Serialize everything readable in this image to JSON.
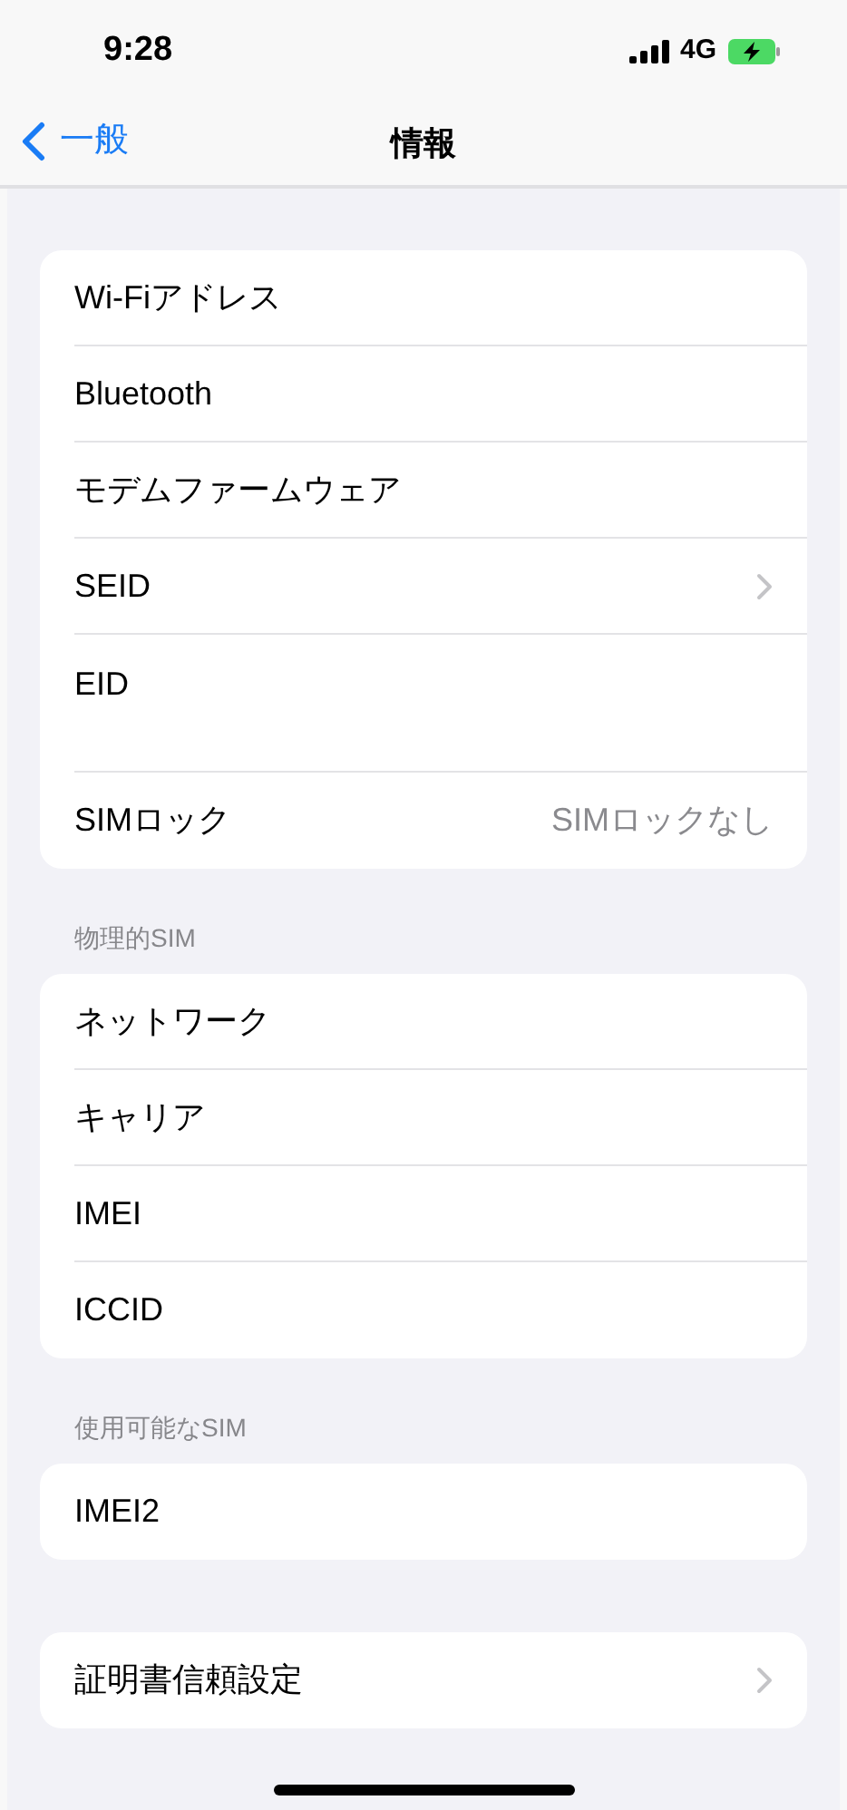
{
  "status_bar": {
    "time": "9:28",
    "network": "4G"
  },
  "nav": {
    "back": "一般",
    "title": "情報"
  },
  "groups": [
    {
      "rows": [
        {
          "label": "Wi-Fiアドレス",
          "kind": "plain"
        },
        {
          "label": "Bluetooth",
          "kind": "plain"
        },
        {
          "label": "モデムファームウェア",
          "kind": "plain"
        },
        {
          "label": "SEID",
          "kind": "link"
        },
        {
          "label": "EID",
          "kind": "tall"
        },
        {
          "label": "SIMロック",
          "kind": "value",
          "value": "SIMロックなし"
        }
      ]
    },
    {
      "header": "物理的SIM",
      "rows": [
        {
          "label": "ネットワーク",
          "kind": "plain"
        },
        {
          "label": "キャリア",
          "kind": "plain"
        },
        {
          "label": "IMEI",
          "kind": "plain"
        },
        {
          "label": "ICCID",
          "kind": "plain"
        }
      ]
    },
    {
      "header": "使用可能なSIM",
      "rows": [
        {
          "label": "IMEI2",
          "kind": "plain"
        }
      ]
    },
    {
      "rows": [
        {
          "label": "証明書信頼設定",
          "kind": "link"
        }
      ]
    }
  ]
}
